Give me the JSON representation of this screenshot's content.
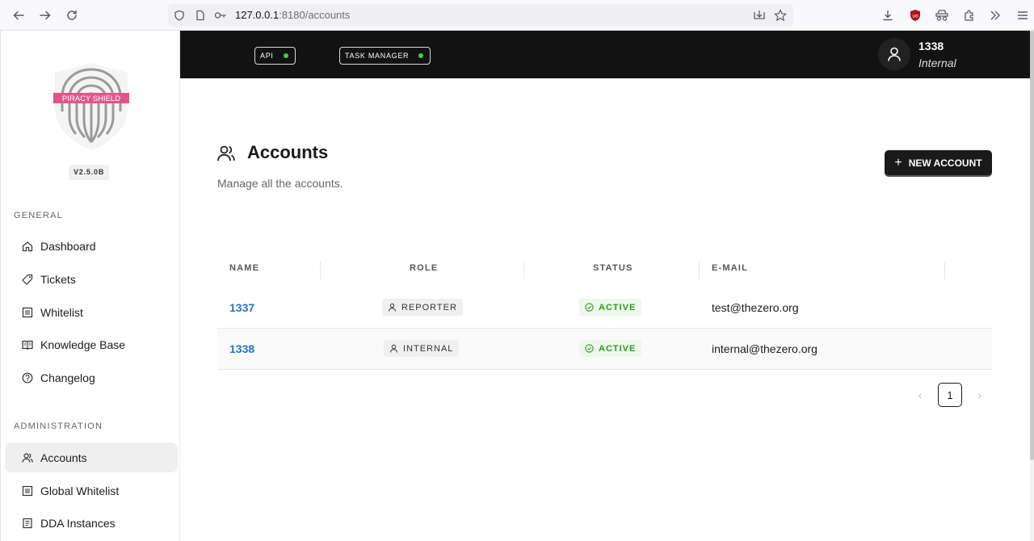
{
  "browser": {
    "url_host": "127.0.0.1",
    "url_rest": ":8180/accounts"
  },
  "sidebar": {
    "logo_text": "PIRACY SHIELD",
    "version": "V2.5.0B",
    "general_label": "GENERAL",
    "general_items": [
      {
        "label": "Dashboard",
        "icon": "home-icon"
      },
      {
        "label": "Tickets",
        "icon": "tag-icon"
      },
      {
        "label": "Whitelist",
        "icon": "list-icon"
      },
      {
        "label": "Knowledge Base",
        "icon": "book-icon"
      },
      {
        "label": "Changelog",
        "icon": "question-icon"
      }
    ],
    "admin_label": "ADMINISTRATION",
    "admin_items": [
      {
        "label": "Accounts",
        "icon": "users-icon",
        "active": true
      },
      {
        "label": "Global Whitelist",
        "icon": "list-icon"
      },
      {
        "label": "DDA Instances",
        "icon": "server-icon"
      }
    ]
  },
  "topbar": {
    "api_label": "API",
    "task_manager_label": "TASK MANAGER",
    "user_name": "1338",
    "user_role": "Internal"
  },
  "page": {
    "title": "Accounts",
    "subtitle": "Manage all the accounts.",
    "new_button": "NEW ACCOUNT"
  },
  "table": {
    "columns": [
      "NAME",
      "ROLE",
      "STATUS",
      "E-MAIL"
    ],
    "rows": [
      {
        "name": "1337",
        "role": "REPORTER",
        "status": "ACTIVE",
        "email": "test@thezero.org"
      },
      {
        "name": "1338",
        "role": "INTERNAL",
        "status": "ACTIVE",
        "email": "internal@thezero.org"
      }
    ]
  },
  "pagination": {
    "current_page": "1",
    "prev": "‹",
    "next": "›"
  },
  "colors": {
    "topbar_bg": "#121212",
    "link": "#1f75c9",
    "status_active": "#2e9b22",
    "indicator_on": "#4cc84a"
  }
}
